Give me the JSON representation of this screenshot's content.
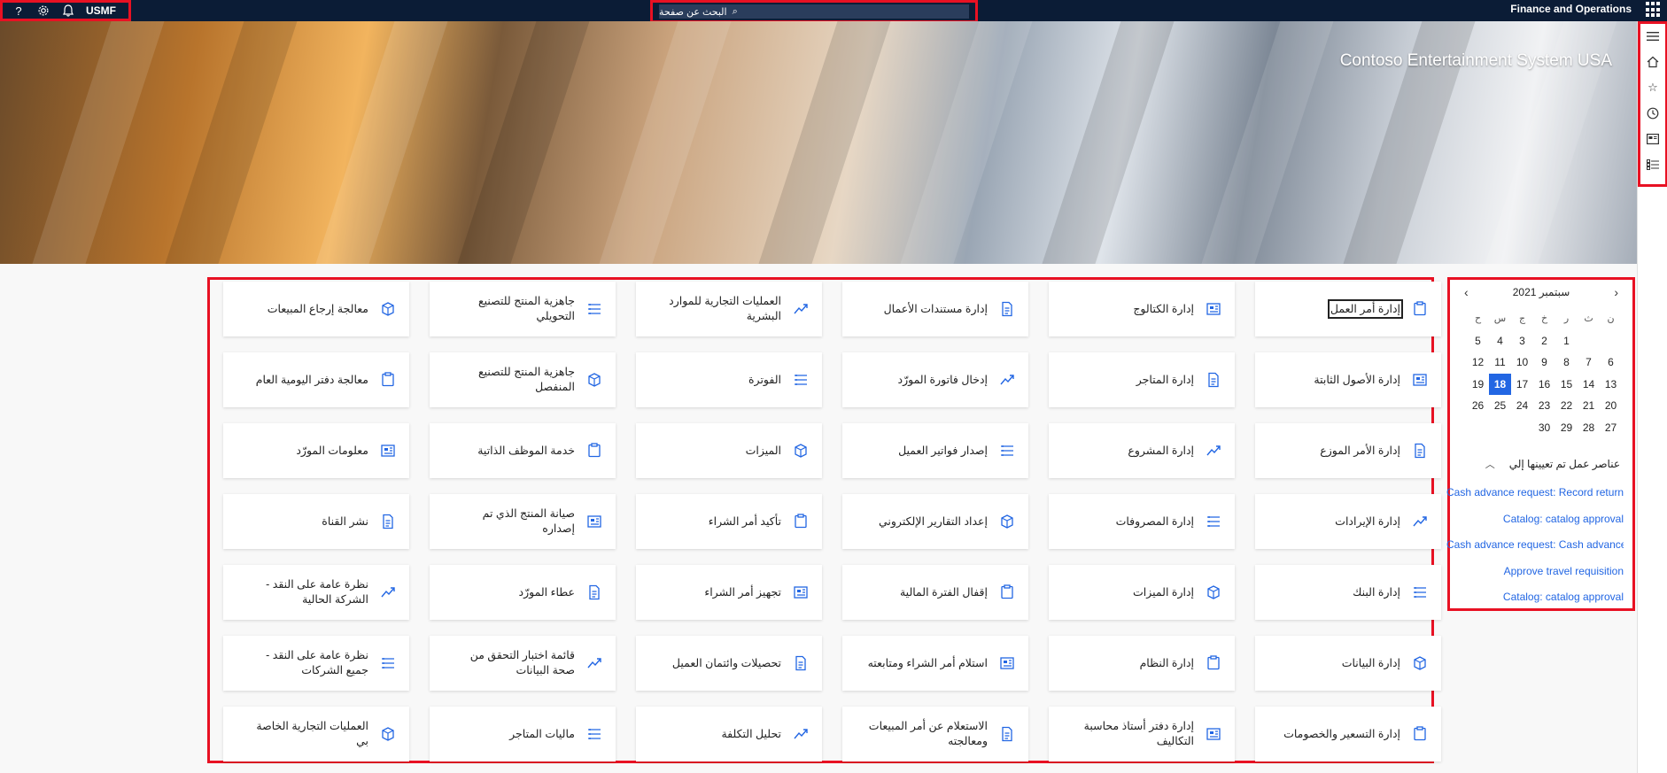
{
  "topbar": {
    "help_icon": "?",
    "company": "USMF",
    "search_placeholder": "البحث عن صفحة",
    "app_title": "Finance and Operations"
  },
  "hero": {
    "company_name": "Contoso Entertainment System USA"
  },
  "navpane": {
    "items": [
      "hamburger-icon",
      "home-icon",
      "star-icon",
      "clock-icon",
      "workspace-icon",
      "modules-icon"
    ]
  },
  "calendar": {
    "month_year": "سبتمبر 2021",
    "days_of_week": [
      "ن",
      "ث",
      "ر",
      "خ",
      "ج",
      "س",
      "ح"
    ],
    "weeks": [
      [
        "",
        "",
        "1",
        "2",
        "3",
        "4",
        "5"
      ],
      [
        "6",
        "7",
        "8",
        "9",
        "10",
        "11",
        "12"
      ],
      [
        "13",
        "14",
        "15",
        "16",
        "17",
        "18",
        "19"
      ],
      [
        "20",
        "21",
        "22",
        "23",
        "24",
        "25",
        "26"
      ],
      [
        "27",
        "28",
        "29",
        "30",
        "",
        "",
        ""
      ]
    ],
    "today": "18"
  },
  "work_items": {
    "title": "عناصر عمل تم تعيينها إلي",
    "items": [
      "Cash advance request: Record returned",
      "Catalog: catalog approval",
      "Cash advance request: Cash advance approval",
      "Approve travel requisition",
      "Catalog: catalog approval"
    ]
  },
  "tiles": [
    [
      "إدارة أمر العمل",
      "إدارة الكتالوج",
      "إدارة مستندات الأعمال",
      "العمليات التجارية للموارد البشرية",
      "جاهزية المنتج للتصنيع التحويلي",
      "معالجة إرجاع المبيعات"
    ],
    [
      "إدارة الأصول الثابتة",
      "إدارة المتاجر",
      "إدخال فاتورة المورّد",
      "الفوترة",
      "جاهزية المنتج للتصنيع المنفصل",
      "معالجة دفتر اليومية العام"
    ],
    [
      "إدارة الأمر الموزع",
      "إدارة المشروع",
      "إصدار فواتير العميل",
      "الميزات",
      "خدمة الموظف الذاتية",
      "معلومات المورّد"
    ],
    [
      "إدارة الإيرادات",
      "إدارة المصروفات",
      "إعداد التقارير الإلكتروني",
      "تأكيد أمر الشراء",
      "صيانة المنتج الذي تم إصداره",
      "نشر القناة"
    ],
    [
      "إدارة البنك",
      "إدارة الميزات",
      "إقفال الفترة المالية",
      "تجهيز أمر الشراء",
      "عطاء المورّد",
      "نظرة عامة على النقد - الشركة الحالية"
    ],
    [
      "إدارة البيانات",
      "إدارة النظام",
      "استلام أمر الشراء ومتابعته",
      "تحصيلات وائتمان العميل",
      "قائمة اختبار التحقق من صحة البيانات",
      "نظرة عامة على النقد - جميع الشركات"
    ],
    [
      "إدارة التسعير والخصومات",
      "إدارة دفتر أستاذ محاسبة التكاليف",
      "الاستعلام عن أمر المبيعات ومعالجته",
      "تحليل التكلفة",
      "ماليات المتاجر",
      "العمليات التجارية الخاصة بي"
    ]
  ]
}
